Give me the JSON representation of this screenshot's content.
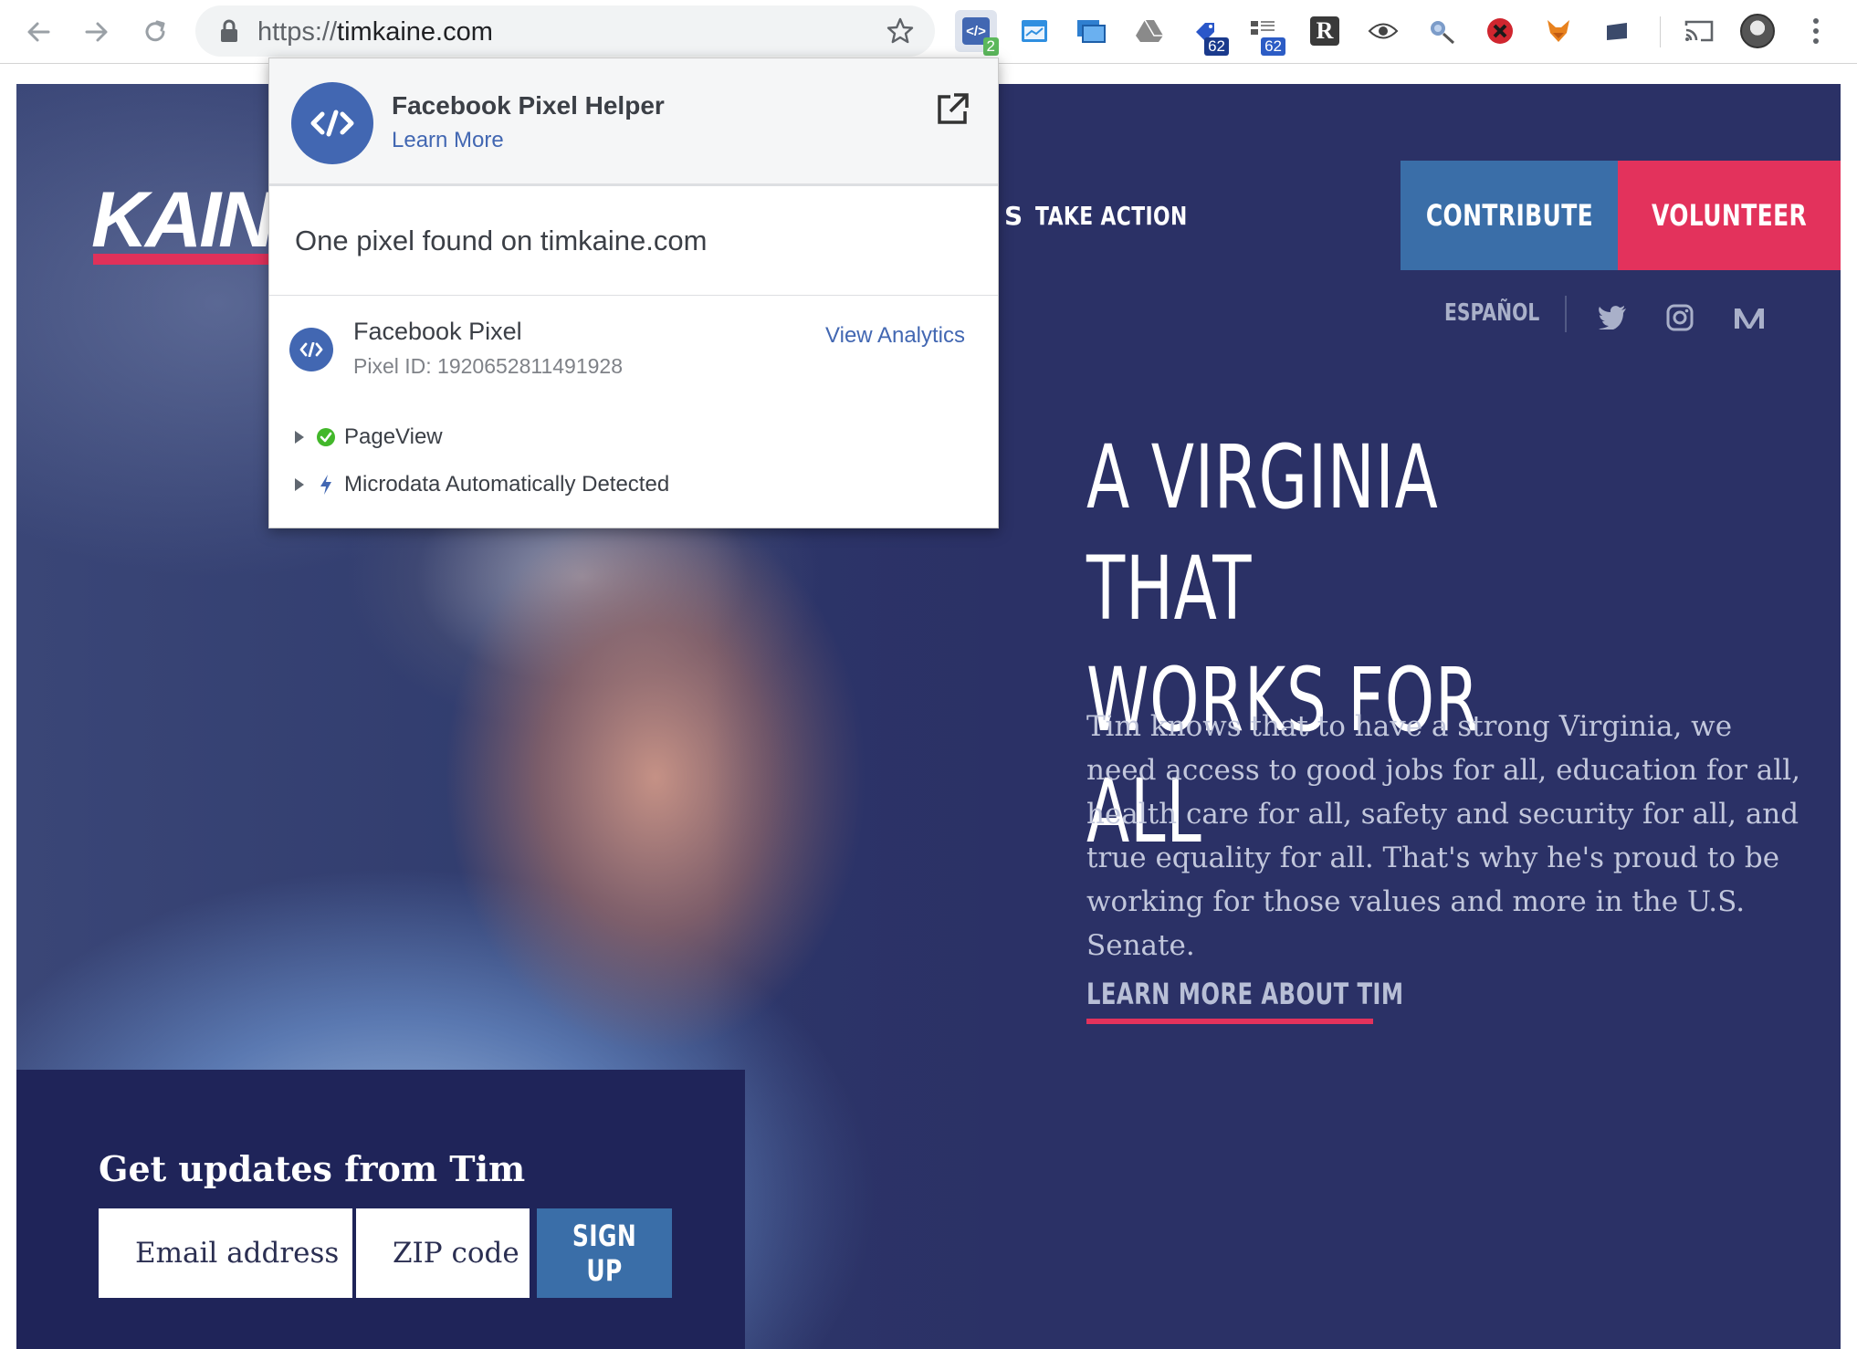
{
  "browser": {
    "url_scheme": "https://",
    "url_host": "timkaine.com",
    "extensions": [
      {
        "name": "facebook-pixel-helper-icon",
        "badge": "2",
        "badge_color": "#5cb85c"
      },
      {
        "name": "window-icon",
        "badge": ""
      },
      {
        "name": "screen-icon",
        "badge": ""
      },
      {
        "name": "drive-icon",
        "badge": ""
      },
      {
        "name": "tag-icon",
        "badge": "62",
        "badge_color": "#1a3a8c"
      },
      {
        "name": "network-icon",
        "badge": "62",
        "badge_color": "#2c5cc5"
      },
      {
        "name": "r-icon",
        "badge": ""
      },
      {
        "name": "eye-icon",
        "badge": ""
      },
      {
        "name": "satellite-icon",
        "badge": ""
      },
      {
        "name": "blocked-icon",
        "badge": ""
      },
      {
        "name": "fox-icon",
        "badge": ""
      },
      {
        "name": "cast-icon",
        "badge": ""
      },
      {
        "name": "avatar",
        "badge": ""
      }
    ]
  },
  "popup": {
    "title": "Facebook Pixel Helper",
    "learn_more": "Learn More",
    "found_text": "One pixel found on timkaine.com",
    "pixel_name": "Facebook Pixel",
    "pixel_id": "Pixel ID: 1920652811491928",
    "view_analytics": "View Analytics",
    "events": [
      {
        "label": "PageView",
        "status": "success",
        "color": "#42b72a"
      },
      {
        "label": "Microdata Automatically Detected",
        "status": "info",
        "color": "#4267b2"
      }
    ]
  },
  "site": {
    "logo": "KAIN",
    "nav_partial": "S",
    "nav_take_action": "TAKE ACTION",
    "contribute": "CONTRIBUTE",
    "volunteer": "VOLUNTEER",
    "espanol": "ESPAÑOL",
    "social": [
      "twitter-icon",
      "instagram-icon",
      "medium-icon"
    ],
    "headline_line1": "A VIRGINIA THAT",
    "headline_line2": "WORKS FOR ALL",
    "body": "Tim knows that to have a strong Virginia, we need access to good jobs for all, education for all, health care for all, safety and security for all, and true equality for all. That's why he's proud to be working for those values and more in the U.S. Senate.",
    "learn_more_link": "LEARN MORE ABOUT TIM",
    "signup_title": "Get updates from Tim",
    "email_placeholder": "Email address",
    "zip_placeholder": "ZIP code",
    "signup_button": "SIGN UP"
  },
  "colors": {
    "page_bg": "#2b3166",
    "contribute": "#3a6ea8",
    "volunteer": "#e3325c",
    "signup_bg": "#1f2459",
    "facebook_blue": "#4267b2"
  }
}
